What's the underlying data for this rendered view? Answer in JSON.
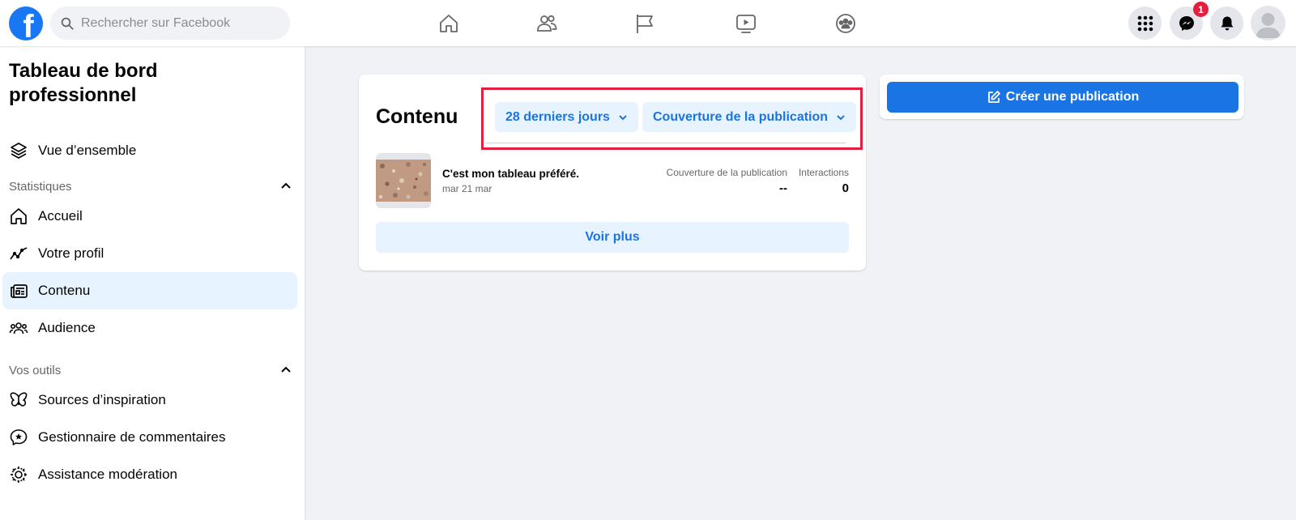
{
  "topbar": {
    "logo_letter": "f",
    "search_placeholder": "Rechercher sur Facebook",
    "nav_icons": [
      "home-icon",
      "friends-icon",
      "pages-flag-icon",
      "watch-video-icon",
      "groups-icon"
    ],
    "right_icons": [
      "menu-grid-icon",
      "messenger-icon",
      "notifications-bell-icon",
      "account-avatar"
    ],
    "messenger_badge": "1"
  },
  "sidebar": {
    "title": "Tableau de bord professionnel",
    "overview": "Vue d’ensemble",
    "sections": [
      {
        "label": "Statistiques",
        "items": [
          {
            "label": "Accueil",
            "icon": "home-outline-icon"
          },
          {
            "label": "Votre profil",
            "icon": "trend-line-icon"
          },
          {
            "label": "Contenu",
            "icon": "content-icon",
            "active": true
          },
          {
            "label": "Audience",
            "icon": "audience-icon"
          }
        ]
      },
      {
        "label": "Vos outils",
        "items": [
          {
            "label": "Sources d’inspiration",
            "icon": "butterfly-icon"
          },
          {
            "label": "Gestionnaire de commentaires",
            "icon": "comment-star-icon"
          },
          {
            "label": "Assistance modération",
            "icon": "moderation-gear-icon"
          }
        ]
      }
    ]
  },
  "content_card": {
    "title": "Contenu",
    "period_filter": "28 derniers jours",
    "metric_filter": "Couverture de la publication",
    "post": {
      "title": "C'est mon tableau préféré.",
      "date": "mar 21 mar",
      "reach_header": "Couverture de la publication",
      "reach_value": "--",
      "interactions_header": "Interactions",
      "interactions_value": "0"
    },
    "see_more": "Voir plus"
  },
  "create_post": {
    "label": "Créer une publication"
  },
  "colors": {
    "brand_blue": "#1877f2",
    "button_blue": "#1b74e4",
    "light_blue_bg": "#e7f3ff",
    "highlight_red": "#e41e3f",
    "page_bg": "#f0f2f5"
  }
}
